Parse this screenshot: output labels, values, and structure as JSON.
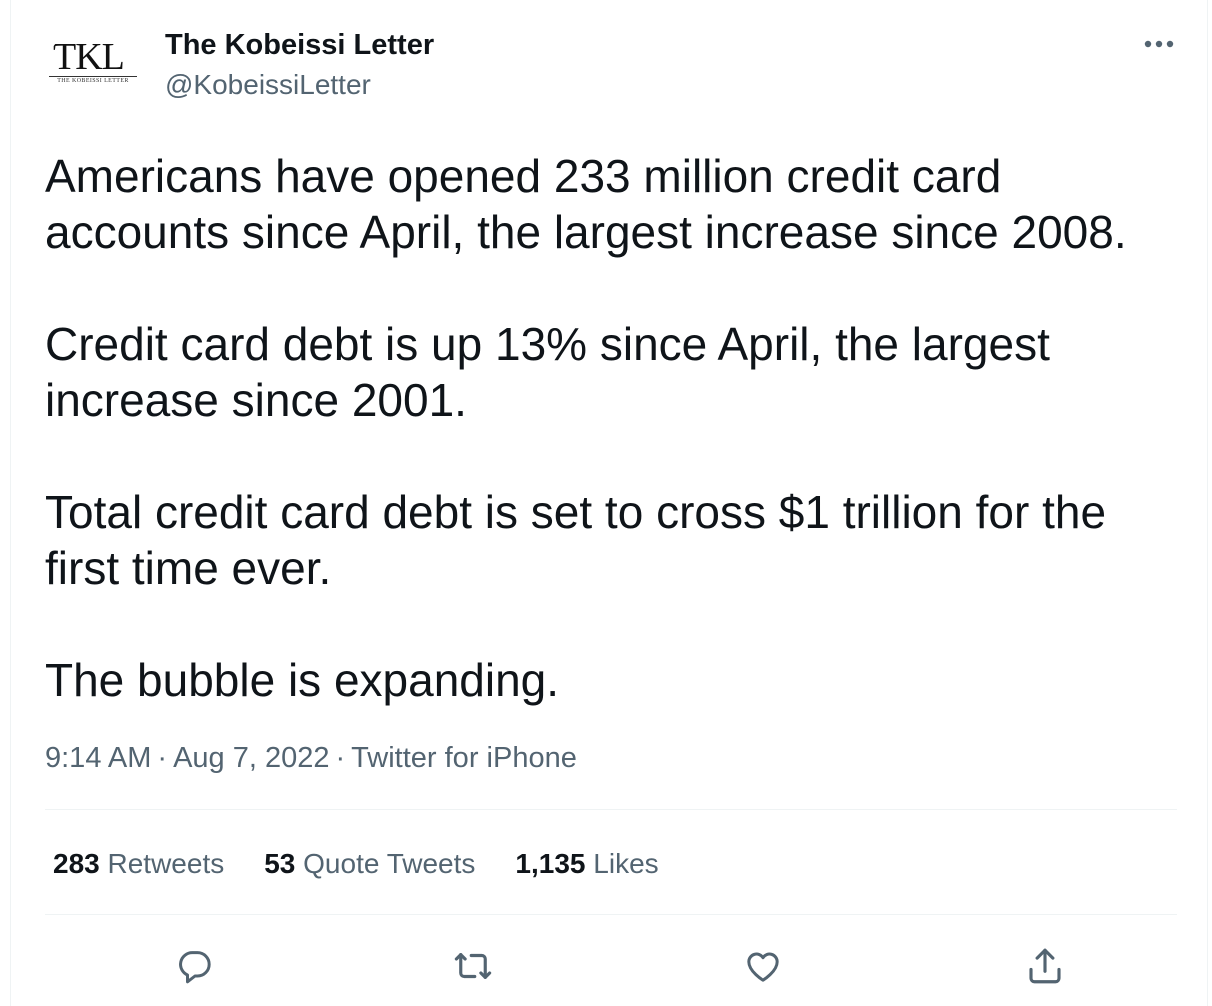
{
  "author": {
    "display_name": "The Kobeissi Letter",
    "handle": "@KobeissiLetter",
    "avatar_mark": "TKL",
    "avatar_subtitle": "THE KOBEISSI LETTER"
  },
  "tweet": {
    "paragraphs": [
      "Americans have opened 233 million credit card accounts since April, the largest increase since 2008.",
      "Credit card debt is up 13% since April, the largest increase since 2001.",
      "Total credit card debt is set to cross $1 trillion for the first time ever.",
      "The bubble is expanding."
    ],
    "time": "9:14 AM",
    "date": "Aug 7, 2022",
    "source": "Twitter for iPhone",
    "separator": "·"
  },
  "stats": {
    "retweets_count": "283",
    "retweets_label": "Retweets",
    "quote_tweets_count": "53",
    "quote_tweets_label": "Quote Tweets",
    "likes_count": "1,135",
    "likes_label": "Likes"
  },
  "icons": {
    "more": "more-horizontal-icon",
    "reply": "reply-icon",
    "retweet": "retweet-icon",
    "like": "heart-icon",
    "share": "share-icon"
  },
  "colors": {
    "text_primary": "#0f1419",
    "text_secondary": "#536471",
    "divider": "#eff3f4"
  }
}
